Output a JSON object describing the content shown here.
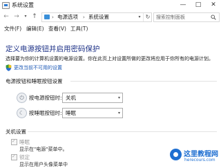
{
  "window": {
    "title": "系统设置",
    "min_glyph": "—",
    "max_glyph": "□",
    "close_glyph": "✕"
  },
  "nav": {
    "back": "←",
    "forward": "→",
    "recent": "▾",
    "up": "↑"
  },
  "address": {
    "sep1": "›",
    "crumbs": [
      "电源选项",
      "系统设置"
    ],
    "sep2": "›",
    "dropdown": "▾",
    "refresh": "↻"
  },
  "search": {
    "placeholder": "搜索控制面板"
  },
  "menu": [
    "文件(F)",
    "编辑(E)",
    "查看(V)",
    "工具(T)"
  ],
  "page": {
    "heading": "定义电源按钮并启用密码保护",
    "description": "选择要为你的计算机设置的电源设置。你在此页上对设置所做的更改将应用于你所有的电源计划。",
    "change_link": "更改当前不可用的设置"
  },
  "buttons_section": {
    "title": "电源按钮和睡眠按钮设置",
    "power_label": "按电源按钮时:",
    "power_value": "关机",
    "sleep_label": "按睡眠按钮时:",
    "sleep_value": "睡眠"
  },
  "shutdown_section": {
    "title": "关机设置",
    "items": [
      {
        "label": "睡眠",
        "checked": true,
        "sub": "显示在\"电源\"菜单中。"
      },
      {
        "label": "锁定",
        "checked": true,
        "sub": "显示在用户头像菜单中"
      }
    ]
  },
  "watermark": {
    "name": "这里教程网",
    "url": "herecours.com"
  },
  "colors": {
    "heading": "#1e3287",
    "link": "#1a57b5",
    "watermark": "#1f6fd1"
  }
}
